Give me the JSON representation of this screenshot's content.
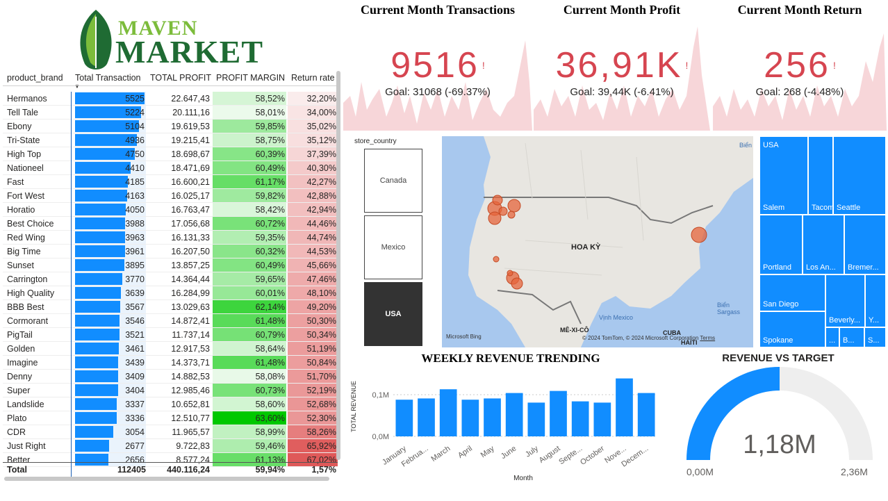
{
  "logo": {
    "maven": "MAVEN",
    "market": "MARKET"
  },
  "table": {
    "headers": [
      "product_brand",
      "Total Transaction",
      "TOTAL PROFIT",
      "PROFIT MARGIN",
      "Return rate"
    ],
    "rows": [
      {
        "brand": "Hermanos",
        "tx": "5525",
        "profit": "22.647,43",
        "margin": "58,52%",
        "ret": "32,20%"
      },
      {
        "brand": "Tell Tale",
        "tx": "5224",
        "profit": "20.111,16",
        "margin": "58,01%",
        "ret": "34,00%"
      },
      {
        "brand": "Ebony",
        "tx": "5104",
        "profit": "19.619,53",
        "margin": "59,85%",
        "ret": "35,02%"
      },
      {
        "brand": "Tri-State",
        "tx": "4936",
        "profit": "19.215,41",
        "margin": "58,75%",
        "ret": "35,12%"
      },
      {
        "brand": "High Top",
        "tx": "4750",
        "profit": "18.698,67",
        "margin": "60,39%",
        "ret": "37,39%"
      },
      {
        "brand": "Nationeel",
        "tx": "4410",
        "profit": "18.471,69",
        "margin": "60,49%",
        "ret": "40,30%"
      },
      {
        "brand": "Fast",
        "tx": "4185",
        "profit": "16.600,21",
        "margin": "61,17%",
        "ret": "42,27%"
      },
      {
        "brand": "Fort West",
        "tx": "4163",
        "profit": "16.025,17",
        "margin": "59,82%",
        "ret": "42,88%"
      },
      {
        "brand": "Horatio",
        "tx": "4050",
        "profit": "16.763,47",
        "margin": "58,42%",
        "ret": "42,94%"
      },
      {
        "brand": "Best Choice",
        "tx": "3988",
        "profit": "17.056,68",
        "margin": "60,72%",
        "ret": "44,46%"
      },
      {
        "brand": "Red Wing",
        "tx": "3963",
        "profit": "16.131,33",
        "margin": "59,35%",
        "ret": "44,74%"
      },
      {
        "brand": "Big Time",
        "tx": "3961",
        "profit": "16.207,50",
        "margin": "60,32%",
        "ret": "44,53%"
      },
      {
        "brand": "Sunset",
        "tx": "3895",
        "profit": "13.857,25",
        "margin": "60,49%",
        "ret": "45,66%"
      },
      {
        "brand": "Carrington",
        "tx": "3770",
        "profit": "14.364,44",
        "margin": "59,65%",
        "ret": "47,46%"
      },
      {
        "brand": "High Quality",
        "tx": "3639",
        "profit": "16.284,99",
        "margin": "60,01%",
        "ret": "48,10%"
      },
      {
        "brand": "BBB Best",
        "tx": "3567",
        "profit": "13.029,63",
        "margin": "62,14%",
        "ret": "49,20%"
      },
      {
        "brand": "Cormorant",
        "tx": "3546",
        "profit": "14.872,41",
        "margin": "61,48%",
        "ret": "50,30%"
      },
      {
        "brand": "PigTail",
        "tx": "3521",
        "profit": "11.737,14",
        "margin": "60,79%",
        "ret": "50,34%"
      },
      {
        "brand": "Golden",
        "tx": "3461",
        "profit": "12.917,53",
        "margin": "58,64%",
        "ret": "51,19%"
      },
      {
        "brand": "Imagine",
        "tx": "3439",
        "profit": "14.373,71",
        "margin": "61,48%",
        "ret": "50,84%"
      },
      {
        "brand": "Denny",
        "tx": "3409",
        "profit": "14.882,53",
        "margin": "58,08%",
        "ret": "51,70%"
      },
      {
        "brand": "Super",
        "tx": "3404",
        "profit": "12.985,46",
        "margin": "60,73%",
        "ret": "52,19%"
      },
      {
        "brand": "Landslide",
        "tx": "3337",
        "profit": "10.652,81",
        "margin": "58,60%",
        "ret": "52,68%"
      },
      {
        "brand": "Plato",
        "tx": "3336",
        "profit": "12.510,77",
        "margin": "63,60%",
        "ret": "52,30%"
      },
      {
        "brand": "CDR",
        "tx": "3054",
        "profit": "11.965,57",
        "margin": "58,99%",
        "ret": "58,26%"
      },
      {
        "brand": "Just Right",
        "tx": "2677",
        "profit": "9.722,83",
        "margin": "59,46%",
        "ret": "65,92%"
      },
      {
        "brand": "Better",
        "tx": "2656",
        "profit": "8.577,24",
        "margin": "61,13%",
        "ret": "67,02%"
      }
    ],
    "total": {
      "label": "Total",
      "tx": "112405",
      "profit": "440.116,24",
      "margin": "59,94%",
      "ret": "1,57%"
    }
  },
  "kpis": [
    {
      "title": "Current Month Transactions",
      "value": "9516",
      "bang": "!",
      "goal": "Goal: 31068 (-69.37%)"
    },
    {
      "title": "Current Month Profit",
      "value": "36,91K",
      "bang": "!",
      "goal": "Goal: 39,44K (-6.41%)"
    },
    {
      "title": "Current Month Return",
      "value": "256",
      "bang": "!",
      "goal": "Goal: 268 (-4.48%)"
    }
  ],
  "slicer": {
    "title": "store_country",
    "options": [
      "Canada",
      "Mexico",
      "USA"
    ],
    "selected": "USA"
  },
  "map": {
    "country_label": "HOA KỲ",
    "labels": [
      "Biển",
      "Biển Sargass",
      "Vịnh Mexico",
      "MÊ-XI-CÔ",
      "CUBA",
      "HAITI"
    ],
    "attribution": "© 2024 TomTom, © 2024 Microsoft Corporation",
    "terms": "Terms",
    "bing": "Microsoft Bing"
  },
  "treemap": {
    "cells": [
      "USA",
      "Salem",
      "Tacoma",
      "Seattle",
      "Portland",
      "Los An...",
      "Bremer...",
      "San Diego",
      "Beverly...",
      "Y...",
      "Spokane",
      "...",
      "B...",
      "S..."
    ]
  },
  "weekly": {
    "title": "WEEKLY REVENUE TRENDING",
    "ylabel": "TOTAL REVENUE",
    "xlabel": "Month",
    "yticks": [
      "0,1M",
      "0,0M"
    ]
  },
  "gauge": {
    "title": "REVENUE VS TARGET",
    "value_label": "1,18M",
    "min_label": "0,00M",
    "max_label": "2,36M",
    "fraction": 0.5
  },
  "colors": {
    "accent": "#118dff",
    "kpi_red": "#d64550",
    "selected": "#333333"
  },
  "chart_data": {
    "type": "bar",
    "title": "WEEKLY REVENUE TRENDING",
    "xlabel": "Month",
    "ylabel": "TOTAL REVENUE",
    "categories": [
      "January",
      "Februa...",
      "March",
      "April",
      "May",
      "June",
      "July",
      "August",
      "Septe...",
      "October",
      "Nove...",
      "Decem..."
    ],
    "values": [
      0.088,
      0.091,
      0.113,
      0.088,
      0.091,
      0.104,
      0.081,
      0.109,
      0.084,
      0.081,
      0.139,
      0.104
    ],
    "ylim": [
      0,
      0.15
    ],
    "grid": true
  }
}
